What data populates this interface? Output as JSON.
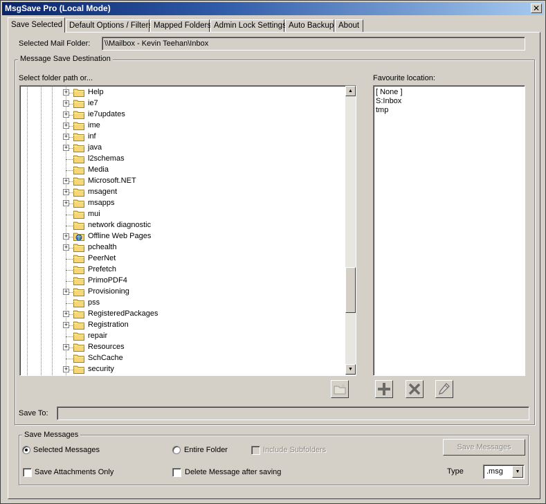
{
  "window": {
    "title": "MsgSave Pro (Local Mode)",
    "close_glyph": "✕"
  },
  "tabs": [
    {
      "label": "Save Selected",
      "active": true
    },
    {
      "label": "Default Options / Filters"
    },
    {
      "label": "Mapped Folders"
    },
    {
      "label": "Admin Lock Settings"
    },
    {
      "label": "Auto Backup"
    },
    {
      "label": "About"
    }
  ],
  "mail_folder": {
    "label": "Selected Mail Folder:",
    "value": "\\\\Mailbox - Kevin Teehan\\Inbox"
  },
  "destination": {
    "group_title": "Message Save Destination",
    "tree_label": "Select folder path or...",
    "tree_items": [
      {
        "label": "Help",
        "expandable": true
      },
      {
        "label": "ie7",
        "expandable": true
      },
      {
        "label": "ie7updates",
        "expandable": true
      },
      {
        "label": "ime",
        "expandable": true
      },
      {
        "label": "inf",
        "expandable": true
      },
      {
        "label": "java",
        "expandable": true
      },
      {
        "label": "l2schemas",
        "expandable": false
      },
      {
        "label": "Media",
        "expandable": false
      },
      {
        "label": "Microsoft.NET",
        "expandable": true
      },
      {
        "label": "msagent",
        "expandable": true
      },
      {
        "label": "msapps",
        "expandable": true
      },
      {
        "label": "mui",
        "expandable": false
      },
      {
        "label": "network diagnostic",
        "expandable": false
      },
      {
        "label": "Offline Web Pages",
        "expandable": true,
        "icon": "web-folder"
      },
      {
        "label": "pchealth",
        "expandable": true
      },
      {
        "label": "PeerNet",
        "expandable": false
      },
      {
        "label": "Prefetch",
        "expandable": false
      },
      {
        "label": "PrimoPDF4",
        "expandable": false
      },
      {
        "label": "Provisioning",
        "expandable": true
      },
      {
        "label": "pss",
        "expandable": false
      },
      {
        "label": "RegisteredPackages",
        "expandable": true
      },
      {
        "label": "Registration",
        "expandable": true
      },
      {
        "label": "repair",
        "expandable": false
      },
      {
        "label": "Resources",
        "expandable": true
      },
      {
        "label": "SchCache",
        "expandable": false
      },
      {
        "label": "security",
        "expandable": true
      }
    ],
    "favourite_label": "Favourite location:",
    "favourites": [
      "[ None ]",
      "S:Inbox",
      "tmp"
    ]
  },
  "save_to": {
    "label": "Save To:",
    "value": ""
  },
  "save_messages": {
    "group_title": "Save Messages",
    "radio_selected": "Selected Messages",
    "radio_entire": "Entire Folder",
    "include_subfolders": "Include Subfolders",
    "save_button": "Save Messages",
    "save_attachments_only": "Save Attachments Only",
    "delete_after": "Delete Message after saving",
    "type_label": "Type",
    "type_value": ".msg"
  },
  "icons": {
    "new_folder": "new-folder-icon",
    "add": "plus-icon",
    "remove": "x-icon",
    "edit": "pencil-icon"
  }
}
